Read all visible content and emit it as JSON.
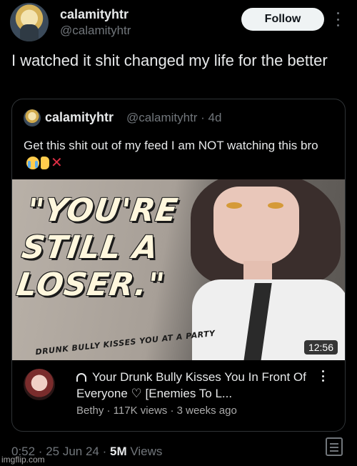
{
  "author": {
    "display_name": "calamityhtr",
    "handle": "@calamityhtr",
    "follow_label": "Follow"
  },
  "tweet": {
    "text": "I watched it shit changed my life for the better"
  },
  "quoted_tweet": {
    "display_name": "calamityhtr",
    "handle_time": "@calamityhtr · 4d",
    "text": "Get this shit out of my feed I am NOT watching this bro",
    "emojis": [
      "loudly-crying-face",
      "thumbs-down",
      "cross-mark"
    ]
  },
  "video": {
    "thumbnail_title": "\"YOU'RE STILL A LOSER.\"",
    "thumbnail_subtitle": "DRUNK BULLY KISSES YOU AT A PARTY",
    "duration": "12:56",
    "title": "Your Drunk Bully Kisses You In Front Of Everyone ♡ [Enemies To L...",
    "channel_info": "Bethy · 117K views · 3 weeks ago"
  },
  "footer": {
    "time_date": "0:52 · 25 Jun 24 · ",
    "views_count": "5M",
    "views_label": " Views"
  },
  "watermark": "imgflip.com",
  "colors": {
    "background": "#000000",
    "text": "#e7e9ea",
    "muted": "#71767b",
    "follow_button": "#eff3f4"
  }
}
